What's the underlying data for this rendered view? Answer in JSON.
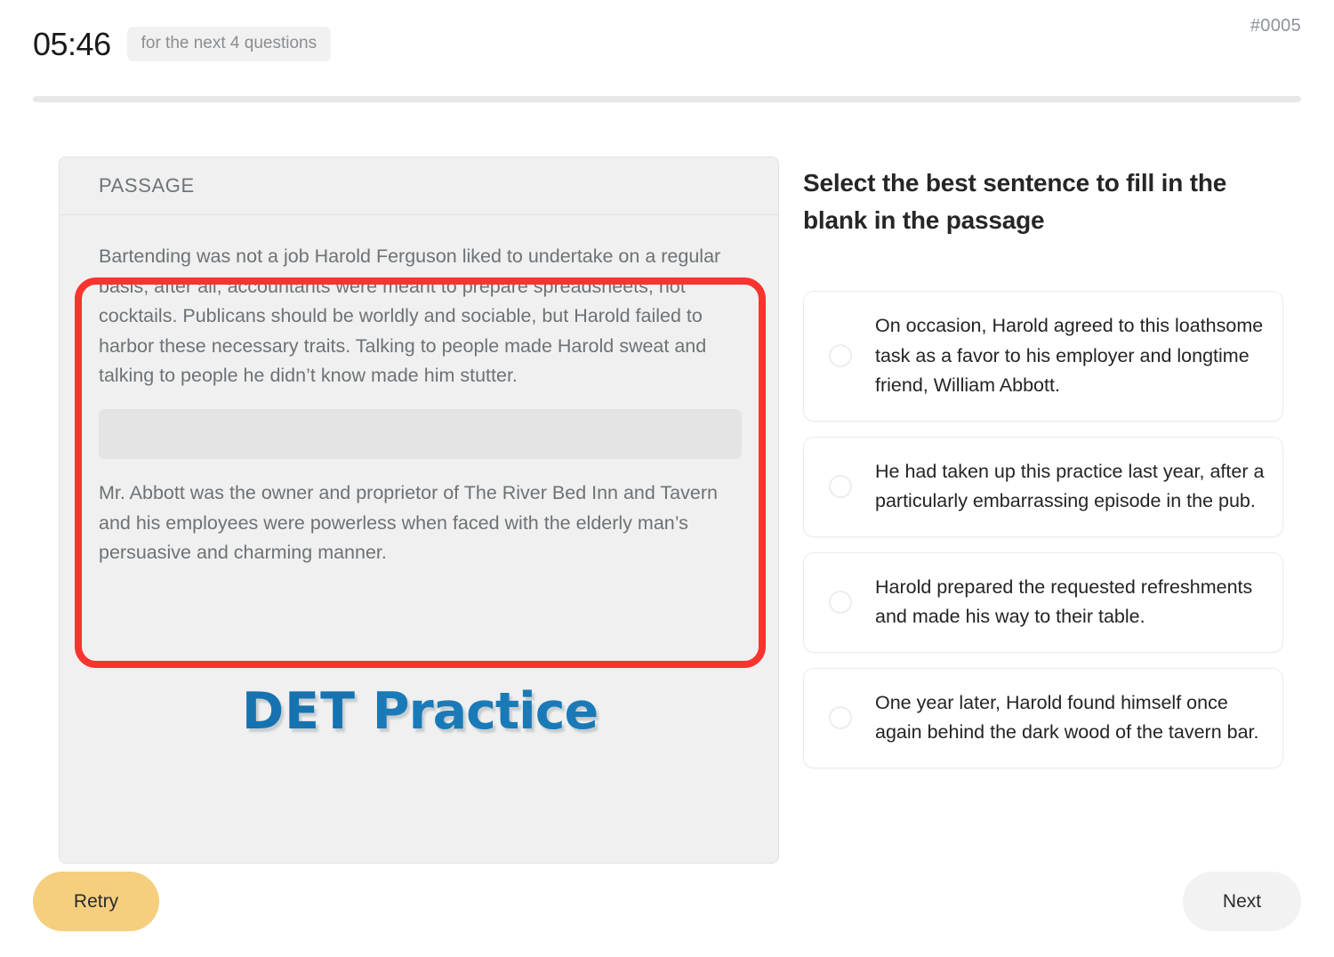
{
  "header": {
    "timer": "05:46",
    "timer_note": "for the next 4 questions",
    "question_id": "#0005",
    "progress_percent": 0
  },
  "passage": {
    "label": "PASSAGE",
    "paragraph_1": "Bartending was not a job Harold Ferguson liked to undertake on a regular basis; after all, accountants were meant to prepare spreadsheets, not cocktails. Publicans should be worldly and sociable, but Harold failed to harbor these necessary traits. Talking to people made Harold sweat and talking to people he didn’t know made him stutter.",
    "blank_placeholder": "",
    "paragraph_2": "Mr. Abbott was the owner and proprietor of The River Bed Inn and Tavern and his employees were powerless when faced with the elderly man’s persuasive and charming manner."
  },
  "logo": {
    "part1": "DET",
    "part2": " Practice"
  },
  "question": {
    "title": "Select the best sentence to fill in the blank in the passage",
    "options": [
      {
        "id": "option-1",
        "text": "On occasion, Harold agreed to this loathsome task as a favor to his employer and longtime friend, William Abbott.",
        "selected": false
      },
      {
        "id": "option-2",
        "text": "He had taken up this practice last year, after a particularly embarrassing episode in the pub.",
        "selected": false
      },
      {
        "id": "option-3",
        "text": "Harold prepared the requested refreshments and made his way to their table.",
        "selected": false
      },
      {
        "id": "option-4",
        "text": "One year later, Harold found himself once again behind the dark wood of the tavern bar.",
        "selected": false
      }
    ]
  },
  "footer": {
    "retry_label": "Retry",
    "next_label": "Next"
  },
  "colors": {
    "highlight_red": "#f9332e",
    "retry_yellow": "#f5cf7e",
    "next_gray": "#f2f2f2",
    "logo_blue": "#1a77b4",
    "passage_bg": "#f0f0f0",
    "blank_bg": "#e4e4e4"
  }
}
